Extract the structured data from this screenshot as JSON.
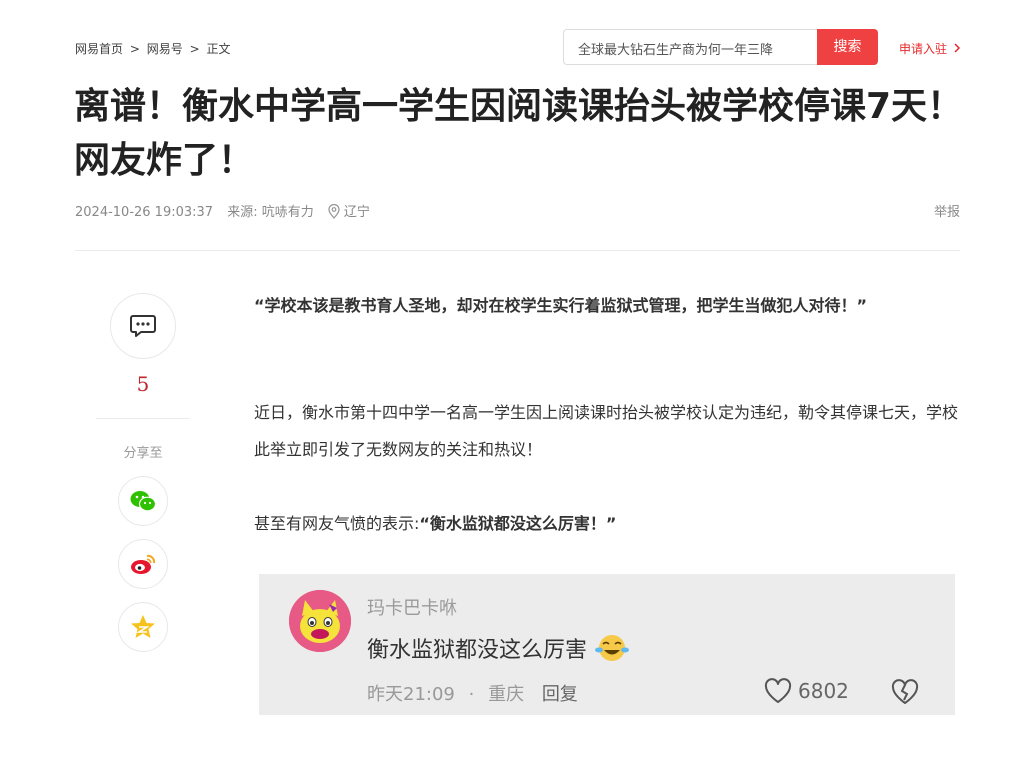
{
  "breadcrumb": {
    "items": [
      "网易首页",
      "网易号",
      "正文"
    ],
    "separator": ">"
  },
  "search": {
    "value": "全球最大钻石生产商为何一年三降",
    "button_label": "搜索"
  },
  "header": {
    "apply_label": "申请入驻"
  },
  "article": {
    "title": "离谱！衡水中学高一学生因阅读课抬头被学校停课7天！网友炸了！",
    "datetime": "2024-10-26 19:03:37",
    "source": "来源: 吭哧有力",
    "location": "辽宁",
    "report_label": "举报",
    "p1": "“学校本该是教书育人圣地，却对在校学生实行着监狱式管理，把学生当做犯人对待！”",
    "p2": "近日，衡水市第十四中学一名高一学生因上阅读课时抬头被学校认定为违纪，勒令其停课七天，学校此举立即引发了无数网友的关注和热议！",
    "p3_prefix": "甚至有网友气愤的表示:",
    "p3_quote": "“衡水监狱都没这么厉害！”"
  },
  "sidebar": {
    "comment_count": "5",
    "share_label": "分享至",
    "share_icons": [
      "wechat-icon",
      "weibo-icon",
      "qzone-icon"
    ]
  },
  "comment": {
    "username": "玛卡巴卡咻",
    "text": "衡水监狱都没这么厉害",
    "time": "昨天21:09",
    "separator": "·",
    "location": "重庆",
    "reply_label": "回复",
    "likes": "6802"
  },
  "colors": {
    "accent": "#f04142",
    "count": "#c0262c"
  }
}
